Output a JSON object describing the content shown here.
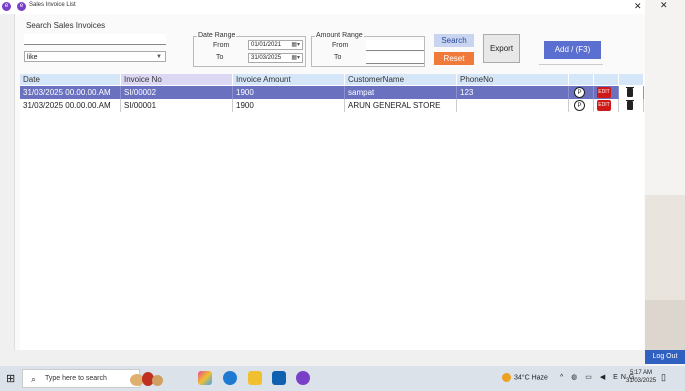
{
  "window": {
    "title": "Sales Invoice List",
    "close_glyph": "✕",
    "outside_close_glyph": "✕"
  },
  "search": {
    "label": "Search Sales Invoices",
    "value": "",
    "mode_value": "like"
  },
  "date_range": {
    "legend": "Date Range",
    "from_label": "From",
    "to_label": "To",
    "from_value": "01/01/2021",
    "to_value": "31/03/2025"
  },
  "amount_range": {
    "legend": "Amount Range",
    "from_label": "From",
    "to_label": "To",
    "from_value": "",
    "to_value": ""
  },
  "buttons": {
    "search": "Search",
    "reset": "Reset",
    "export": "Export",
    "add": "Add / (F3)"
  },
  "table": {
    "columns": [
      "Date",
      "Invoice No",
      "Invoice Amount",
      "CustomerName",
      "PhoneNo"
    ],
    "rows": [
      {
        "date": "31/03/2025 00.00.00.AM",
        "invoice_no": "SI/00002",
        "amount": "1900",
        "customer": "sampat",
        "phone": "123",
        "selected": true
      },
      {
        "date": "31/03/2025 00.00.00.AM",
        "invoice_no": "SI/00001",
        "amount": "1900",
        "customer": "ARUN GENERAL STORE",
        "phone": "",
        "selected": false
      }
    ],
    "row_icons": {
      "print": "P",
      "edit": "EDIT"
    }
  },
  "side": {
    "logout": "Log Out",
    "left_badge": "Y"
  },
  "taskbar": {
    "start_glyph": "⊞",
    "search_placeholder": "Type here to search",
    "weather": "34°C Haze",
    "tray": "^ ◍ ▭ ◀ ENG",
    "time": "5:17 AM",
    "date": "31/03/2025",
    "notif_glyph": "▯"
  }
}
